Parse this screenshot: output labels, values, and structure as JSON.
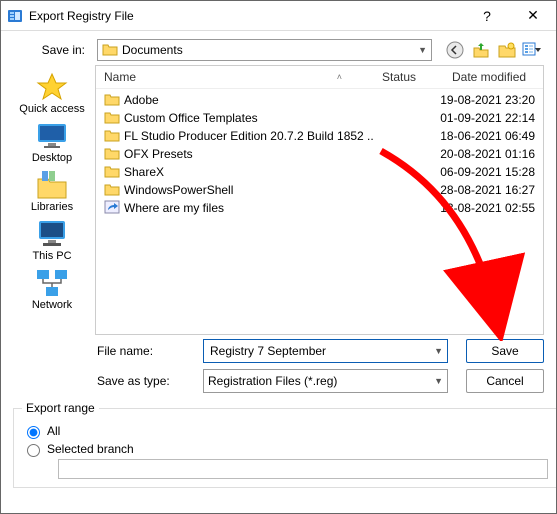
{
  "window": {
    "title": "Export Registry File"
  },
  "titlebar_controls": {
    "minimize": "—",
    "close": "✕"
  },
  "top": {
    "savein_label": "Save in:",
    "savein_value": "Documents",
    "toolbar": [
      "back",
      "uplevel",
      "newfolder",
      "viewmenu"
    ]
  },
  "places": [
    {
      "label": "Quick access",
      "kind": "star"
    },
    {
      "label": "Desktop",
      "kind": "desktop"
    },
    {
      "label": "Libraries",
      "kind": "libraries"
    },
    {
      "label": "This PC",
      "kind": "thispc"
    },
    {
      "label": "Network",
      "kind": "network"
    }
  ],
  "columns": {
    "name": "Name",
    "status": "Status",
    "date": "Date modified"
  },
  "files": [
    {
      "name": "Adobe",
      "status": "",
      "date": "19-08-2021 23:20",
      "kind": "folder"
    },
    {
      "name": "Custom Office Templates",
      "status": "",
      "date": "01-09-2021 22:14",
      "kind": "folder"
    },
    {
      "name": "FL Studio Producer Edition 20.7.2 Build 1852 ...",
      "status": "",
      "date": "18-06-2021 06:49",
      "kind": "folder"
    },
    {
      "name": "OFX Presets",
      "status": "",
      "date": "20-08-2021 01:16",
      "kind": "folder"
    },
    {
      "name": "ShareX",
      "status": "",
      "date": "06-09-2021 15:28",
      "kind": "folder"
    },
    {
      "name": "WindowsPowerShell",
      "status": "",
      "date": "28-08-2021 16:27",
      "kind": "folder"
    },
    {
      "name": "Where are my files",
      "status": "",
      "date": "13-08-2021 02:55",
      "kind": "shortcut"
    }
  ],
  "fields": {
    "filename_label": "File name:",
    "filename_value": "Registry 7 September",
    "type_label": "Save as type:",
    "type_value": "Registration Files (*.reg)",
    "save_btn": "Save",
    "cancel_btn": "Cancel"
  },
  "range": {
    "legend": "Export range",
    "all": "All",
    "selected": "Selected branch",
    "selected_branch_value": ""
  }
}
